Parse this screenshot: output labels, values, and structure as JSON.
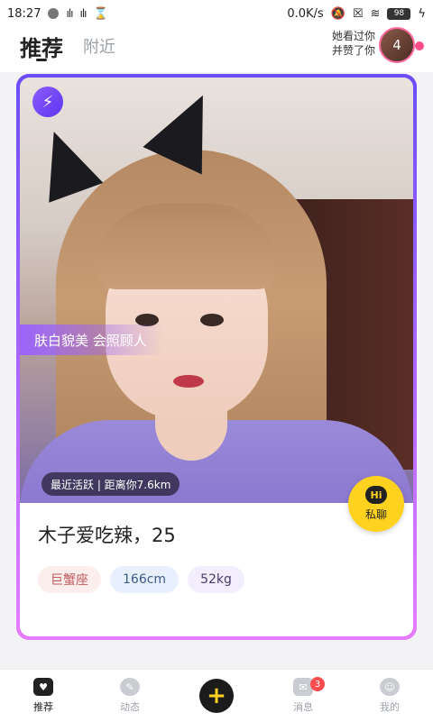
{
  "status": {
    "time": "18:27",
    "network_speed": "0.0K/s",
    "battery": "98",
    "left_icons": [
      "circle-icon",
      "signal-icon",
      "signal-icon",
      "hourglass-icon"
    ],
    "right_icons": [
      "mute-icon",
      "close-box-icon",
      "wifi-icon",
      "battery-icon",
      "charging-icon"
    ]
  },
  "header": {
    "tab_recommend": "推荐",
    "tab_nearby": "附近",
    "liked_line1": "她看过你",
    "liked_line2": "并赞了你",
    "liked_count": "4"
  },
  "card": {
    "tagline": "肤白貌美 会照顾人",
    "activity": "最近活跃 | 距离你7.6km",
    "name": "木子爱吃辣，25",
    "tags": [
      "巨蟹座",
      "166cm",
      "52kg"
    ],
    "chat_badge": "Hi",
    "chat_label": "私聊"
  },
  "nav": {
    "items": [
      {
        "label": "推荐",
        "icon": "heart-card-icon"
      },
      {
        "label": "动态",
        "icon": "compass-icon"
      },
      {
        "label": "",
        "icon": "plus-icon"
      },
      {
        "label": "消息",
        "icon": "mail-icon",
        "badge": "3"
      },
      {
        "label": "我的",
        "icon": "smiley-icon"
      }
    ],
    "plus": "+"
  },
  "colors": {
    "accent_purple": "#7a55ff",
    "chat_yellow": "#ffd21f",
    "badge_red": "#ff4d4f"
  }
}
